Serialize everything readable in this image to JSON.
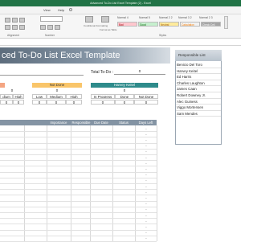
{
  "window": {
    "title": "Advanced To-Do List Excel Template (2) - Excel"
  },
  "ribbon_tabs": [
    "View",
    "Help"
  ],
  "ribbon": {
    "group_alignment": "Alignment",
    "group_number": "Number",
    "group_styles": "Styles",
    "conditional_formatting": "Conditional Formatting",
    "format_as_table": "Format as Table",
    "styles": [
      {
        "label": "Normal 4",
        "cell": "Bad"
      },
      {
        "label": "Normal 5",
        "cell": "Good"
      },
      {
        "label": "Normal 2 2",
        "cell": "Neutral"
      },
      {
        "label": "Normal 3 2",
        "cell": "Calculation"
      },
      {
        "label": "Normal 2 3",
        "cell": "Check Cell"
      }
    ],
    "colors": {
      "bad": "#ffc7ce",
      "good": "#c6efce",
      "neutral": "#ffeb9c",
      "check": "#a5a5a5"
    }
  },
  "sheet": {
    "banner_title": "ced To-Do List Excel Template",
    "total_todo_label": "Total To-Do :",
    "total_todo_value": "0",
    "priority_block": {
      "title": "Not Done",
      "value": "0",
      "headers": [
        "Low",
        "Medium",
        "High"
      ],
      "values": [
        "0",
        "0",
        "0"
      ]
    },
    "left_partial": {
      "value": "0",
      "headers": [
        "dium",
        "High"
      ],
      "values": [
        "0",
        "0"
      ]
    },
    "status_block": {
      "title": "Harvey Keitel",
      "value": "0",
      "headers": [
        "In Progress",
        "Done",
        "Not Done"
      ],
      "values": [
        "0",
        "0",
        "0"
      ]
    },
    "table_headers": [
      "Importance",
      "Responsible",
      "Due Date",
      "Status",
      "Days Left"
    ],
    "row_dash": "-"
  },
  "responsible": {
    "title": "Responsible List",
    "names": [
      "Benicio Del Toro",
      "Harvey Keitel",
      "Ed Harris",
      "Charles Laughton",
      "James Caan",
      "Robert Downey Jr.",
      "Alec Guiness",
      "Viggo Mortensen",
      "Sam Mendes"
    ]
  },
  "colors": {
    "excel_green": "#217346",
    "header_salmon": "#f4a582",
    "header_orange": "#f9c56a",
    "header_teal": "#2e8b8b",
    "banner": "#6f7f8f",
    "table_header": "#8494a4"
  }
}
